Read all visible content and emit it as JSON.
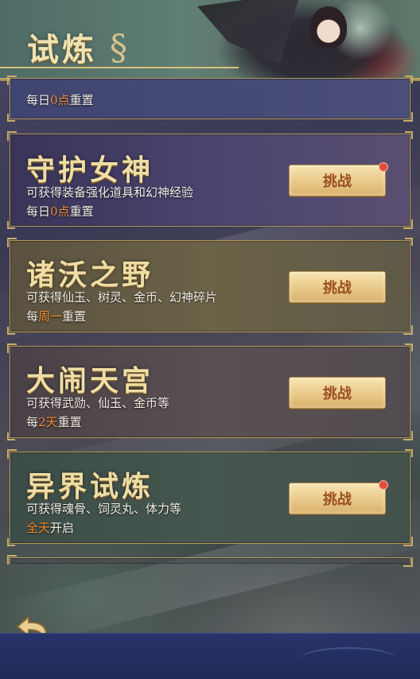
{
  "header": {
    "title": "试炼"
  },
  "partial_card": {
    "reset_prefix": "每日",
    "reset_highlight": "0点",
    "reset_suffix": "重置"
  },
  "cards": [
    {
      "title": "守护女神",
      "desc": "可获得装备强化道具和幻神经验",
      "reset_prefix": "每日",
      "reset_highlight": "0点",
      "reset_suffix": "重置",
      "button": "挑战",
      "red_dot": true
    },
    {
      "title": "诸沃之野",
      "desc": "可获得仙玉、树灵、金币、幻神碎片",
      "reset_prefix": "每",
      "reset_highlight": "周一",
      "reset_suffix": "重置",
      "button": "挑战",
      "red_dot": false
    },
    {
      "title": "大闹天宫",
      "desc": "可获得武勋、仙玉、金币等",
      "reset_prefix": "每",
      "reset_highlight": "2天",
      "reset_suffix": "重置",
      "button": "挑战",
      "red_dot": false
    },
    {
      "title": "异界试炼",
      "desc": "可获得魂骨、饲灵丸、体力等",
      "reset_prefix": "",
      "reset_highlight": "全天",
      "reset_suffix": "开启",
      "button": "挑战",
      "red_dot": true
    }
  ],
  "icons": {
    "back": "back-arrow-icon"
  },
  "colors": {
    "title_gold": "#f0dda3",
    "highlight_orange": "#f08a2c",
    "button_text": "#9a4e20",
    "badge_red": "#e64b3c"
  }
}
